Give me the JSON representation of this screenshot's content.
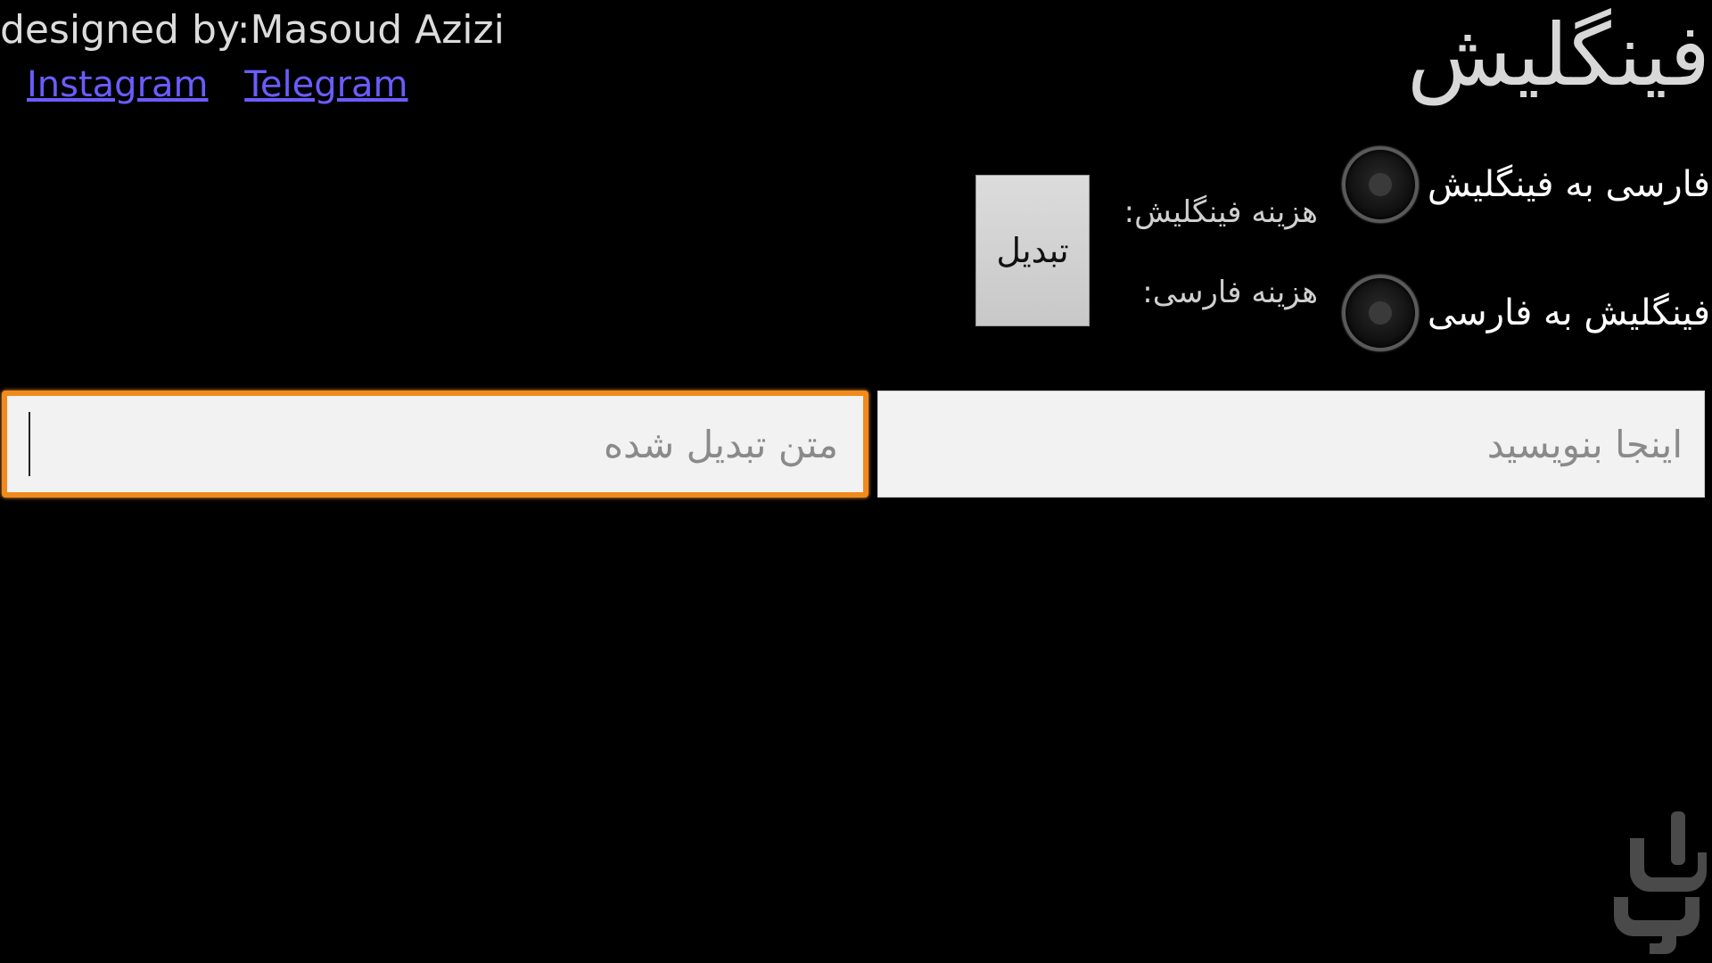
{
  "header": {
    "credit": "designed by:Masoud Azizi",
    "links": [
      "Instagram",
      "Telegram"
    ],
    "app_title": "فینگلیش"
  },
  "options": {
    "fa_to_finglish": "فارسی به فینگلیش",
    "finglish_to_fa": "فینگلیش به فارسی",
    "finglish_cost": "هزینه فینگلیش:",
    "farsi_cost": "هزینه فارسی:"
  },
  "actions": {
    "convert_label": "تبدیل"
  },
  "fields": {
    "input_placeholder": "اینجا بنویسید",
    "output_placeholder": "متن تبدیل شده"
  },
  "colors": {
    "background": "#000000",
    "link": "#6a5cff",
    "focus_border": "#f08a1c",
    "field_bg": "#f2f2f2"
  }
}
